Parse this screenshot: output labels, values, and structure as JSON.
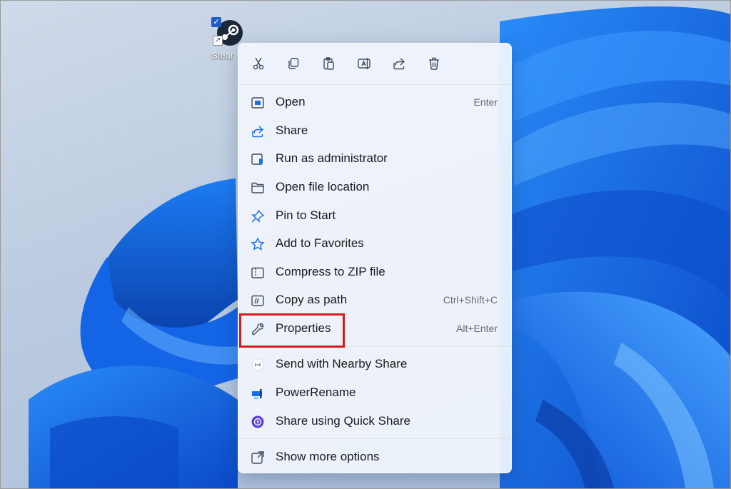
{
  "desktop": {
    "icon_label": "Stear"
  },
  "menu": {
    "toolbar": [
      {
        "name": "cut-icon"
      },
      {
        "name": "copy-icon"
      },
      {
        "name": "paste-icon"
      },
      {
        "name": "rename-icon"
      },
      {
        "name": "share-icon"
      },
      {
        "name": "delete-icon"
      }
    ],
    "items": [
      {
        "label": "Open",
        "shortcut": "Enter",
        "icon": "open-icon"
      },
      {
        "label": "Share",
        "shortcut": "",
        "icon": "share-icon"
      },
      {
        "label": "Run as administrator",
        "shortcut": "",
        "icon": "shield-icon"
      },
      {
        "label": "Open file location",
        "shortcut": "",
        "icon": "folder-icon"
      },
      {
        "label": "Pin to Start",
        "shortcut": "",
        "icon": "pin-icon"
      },
      {
        "label": "Add to Favorites",
        "shortcut": "",
        "icon": "star-icon"
      },
      {
        "label": "Compress to ZIP file",
        "shortcut": "",
        "icon": "zip-icon"
      },
      {
        "label": "Copy as path",
        "shortcut": "Ctrl+Shift+C",
        "icon": "copy-path-icon"
      },
      {
        "label": "Properties",
        "shortcut": "Alt+Enter",
        "icon": "wrench-icon"
      }
    ],
    "extensions": [
      {
        "label": "Send with Nearby Share",
        "icon": "nearby-share-icon"
      },
      {
        "label": "PowerRename",
        "icon": "powerrename-icon"
      },
      {
        "label": "Share using Quick Share",
        "icon": "quick-share-icon"
      }
    ],
    "more": {
      "label": "Show more options",
      "icon": "more-options-icon"
    }
  },
  "colors": {
    "highlight_border": "#d51b1b",
    "accent": "#1a6ce8",
    "menu_bg": "#f0f4fc"
  }
}
